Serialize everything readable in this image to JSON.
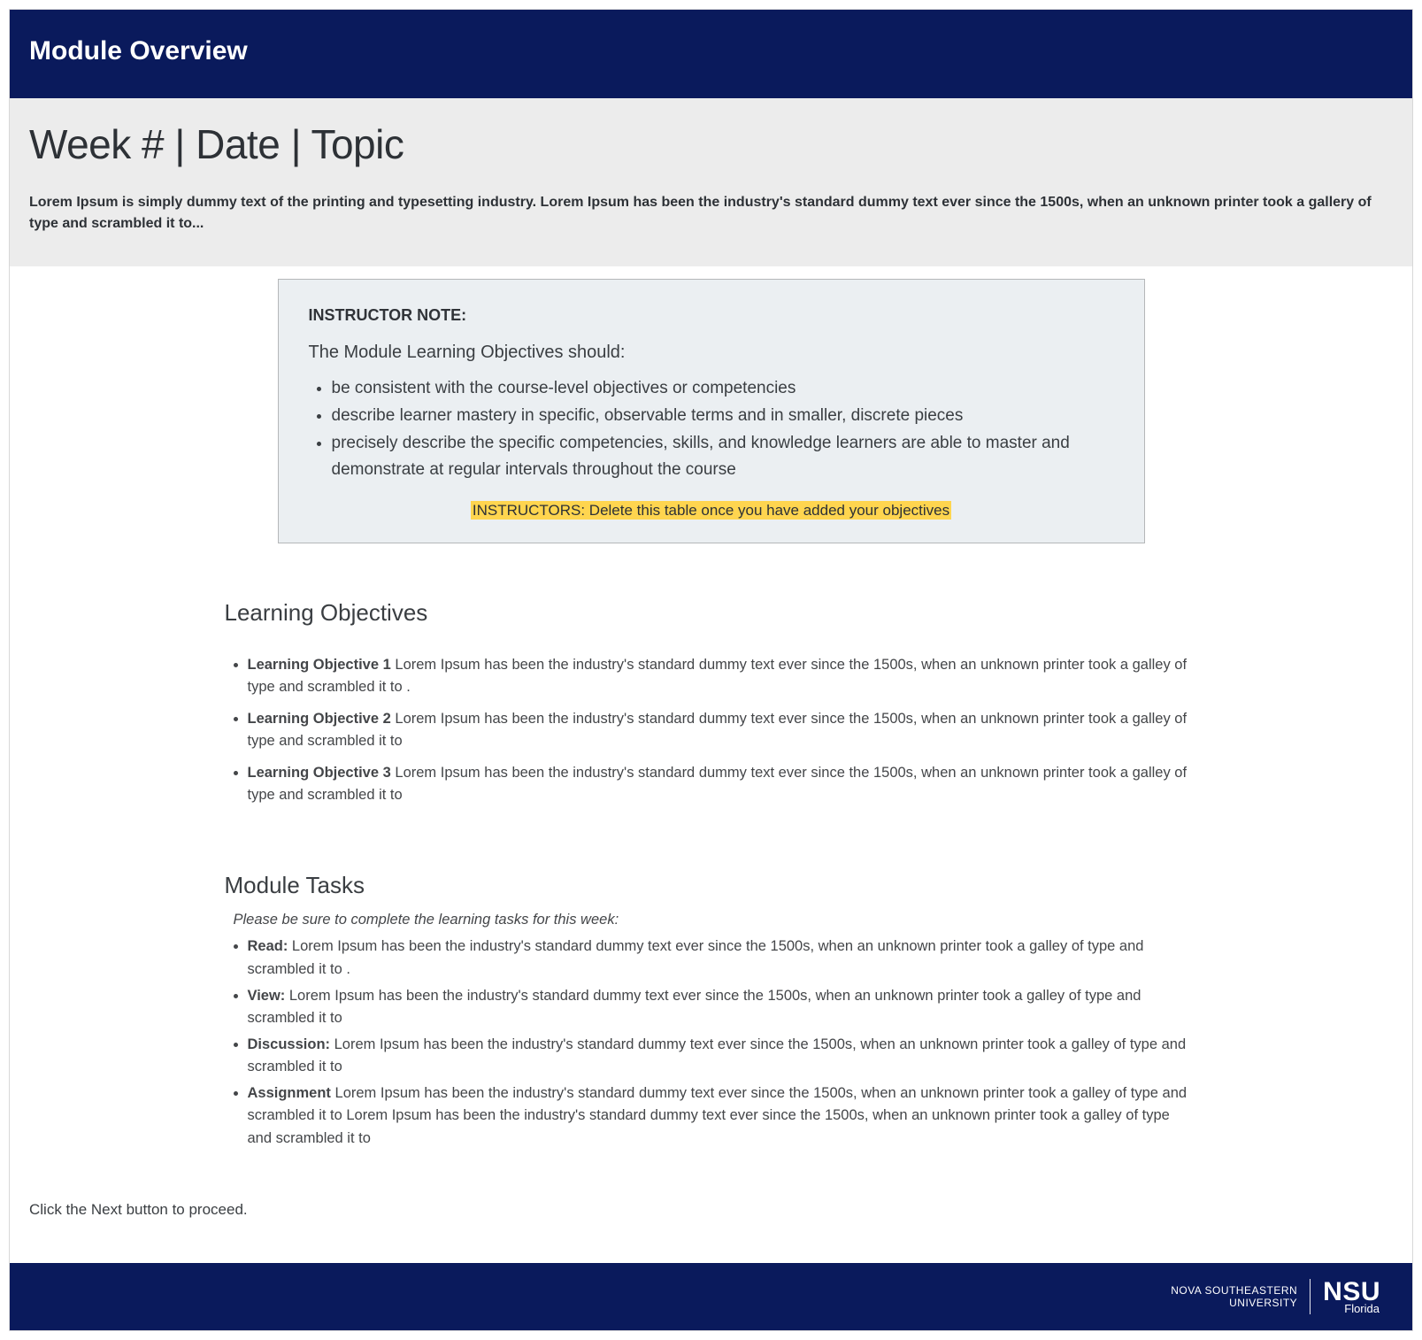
{
  "header": {
    "title": "Module Overview"
  },
  "intro": {
    "heading": "Week # | Date | Topic",
    "blurb": "Lorem Ipsum is simply dummy text of the printing and typesetting industry. Lorem Ipsum has been the industry's standard dummy text ever since the 1500s, when an unknown printer took a gallery of type and scrambled it to..."
  },
  "note": {
    "title": "INSTRUCTOR NOTE:",
    "intro": "The Module Learning Objectives should:",
    "bullets": [
      "be consistent with the course-level objectives or competencies",
      "describe learner mastery in specific, observable terms and in smaller, discrete pieces",
      "precisely describe the specific competencies, skills, and knowledge learners are able to master and demonstrate at regular intervals throughout the course"
    ],
    "delete_warning": "INSTRUCTORS: Delete this table once you have added your objectives"
  },
  "learning_objectives": {
    "heading": "Learning Objectives",
    "items": [
      {
        "label": "Learning Objective 1",
        "text": " Lorem Ipsum has been the industry's standard dummy text ever since the 1500s, when an unknown printer took a galley of type and scrambled it to ."
      },
      {
        "label": "Learning Objective 2",
        "text": " Lorem Ipsum has been the industry's standard dummy text ever since the 1500s, when an unknown printer took a galley of type and scrambled it to"
      },
      {
        "label": "Learning Objective 3",
        "text": " Lorem Ipsum has been the industry's standard dummy text ever since the 1500s, when an unknown printer took a galley of type and scrambled it to"
      }
    ]
  },
  "module_tasks": {
    "heading": "Module Tasks",
    "intro": "Please be sure to complete the learning tasks for this week:",
    "items": [
      {
        "label": "Read:",
        "text": " Lorem Ipsum has been the industry's standard dummy text ever since the 1500s, when an unknown printer took a galley of type and scrambled it to ."
      },
      {
        "label": "View:",
        "text": " Lorem Ipsum has been the industry's standard dummy text ever since the 1500s, when an unknown printer took a galley of type and scrambled it to"
      },
      {
        "label": "Discussion:",
        "text": " Lorem Ipsum has been the industry's standard dummy text ever since the 1500s, when an unknown printer took a galley of type and scrambled it to"
      },
      {
        "label": "Assignment",
        "text": " Lorem Ipsum has been the industry's standard dummy text ever since the 1500s, when an unknown printer took a galley of type and scrambled it to Lorem Ipsum has been the industry's standard dummy text ever since the 1500s, when an unknown printer took a galley of type and scrambled it to"
      }
    ]
  },
  "proceed_text": "Click the Next button to proceed.",
  "footer": {
    "line1": "NOVA SOUTHEASTERN",
    "line2": "UNIVERSITY",
    "logo_big": "NSU",
    "logo_small": "Florida"
  }
}
